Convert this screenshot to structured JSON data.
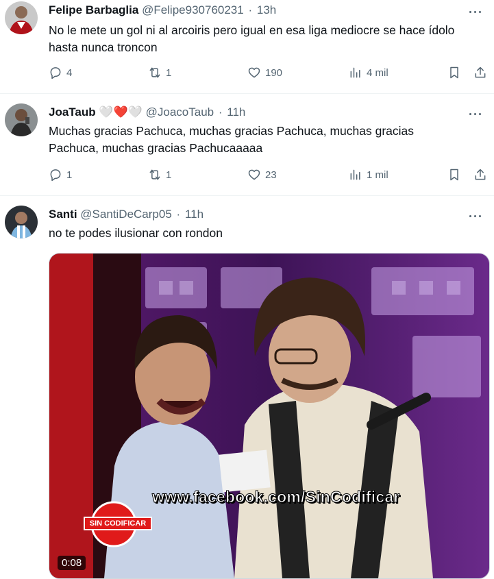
{
  "tweets": [
    {
      "name": "Felipe Barbaglia",
      "handle": "@Felipe930760231",
      "time": "13h",
      "text": "No le mete un gol ni al arcoiris pero igual en esa liga mediocre se hace ídolo hasta nunca troncon",
      "replies": "4",
      "reposts": "1",
      "likes": "190",
      "views": "4 mil"
    },
    {
      "name": "JoaTaub",
      "name_emoji": "🤍❤️🤍",
      "handle": "@JoacoTaub",
      "time": "11h",
      "text": "Muchas gracias Pachuca, muchas gracias Pachuca, muchas gracias Pachuca, muchas gracias Pachucaaaaa",
      "replies": "1",
      "reposts": "1",
      "likes": "23",
      "views": "1 mil"
    },
    {
      "name": "Santi",
      "handle": "@SantiDeCarp05",
      "time": "11h",
      "text": "no te podes ilusionar con rondon",
      "media": {
        "duration": "0:08",
        "watermark": "www.facebook.com/SinCodificar",
        "logo_text": "SIN CODIFICAR"
      }
    }
  ],
  "separator": "·",
  "colors": {
    "text": "#0f1419",
    "secondary": "#536471",
    "border": "#eff3f4",
    "heart_red": "#e0245e"
  },
  "icons": [
    "more-icon",
    "reply-icon",
    "repost-icon",
    "like-icon",
    "views-icon",
    "bookmark-icon",
    "share-icon",
    "play-duration"
  ]
}
